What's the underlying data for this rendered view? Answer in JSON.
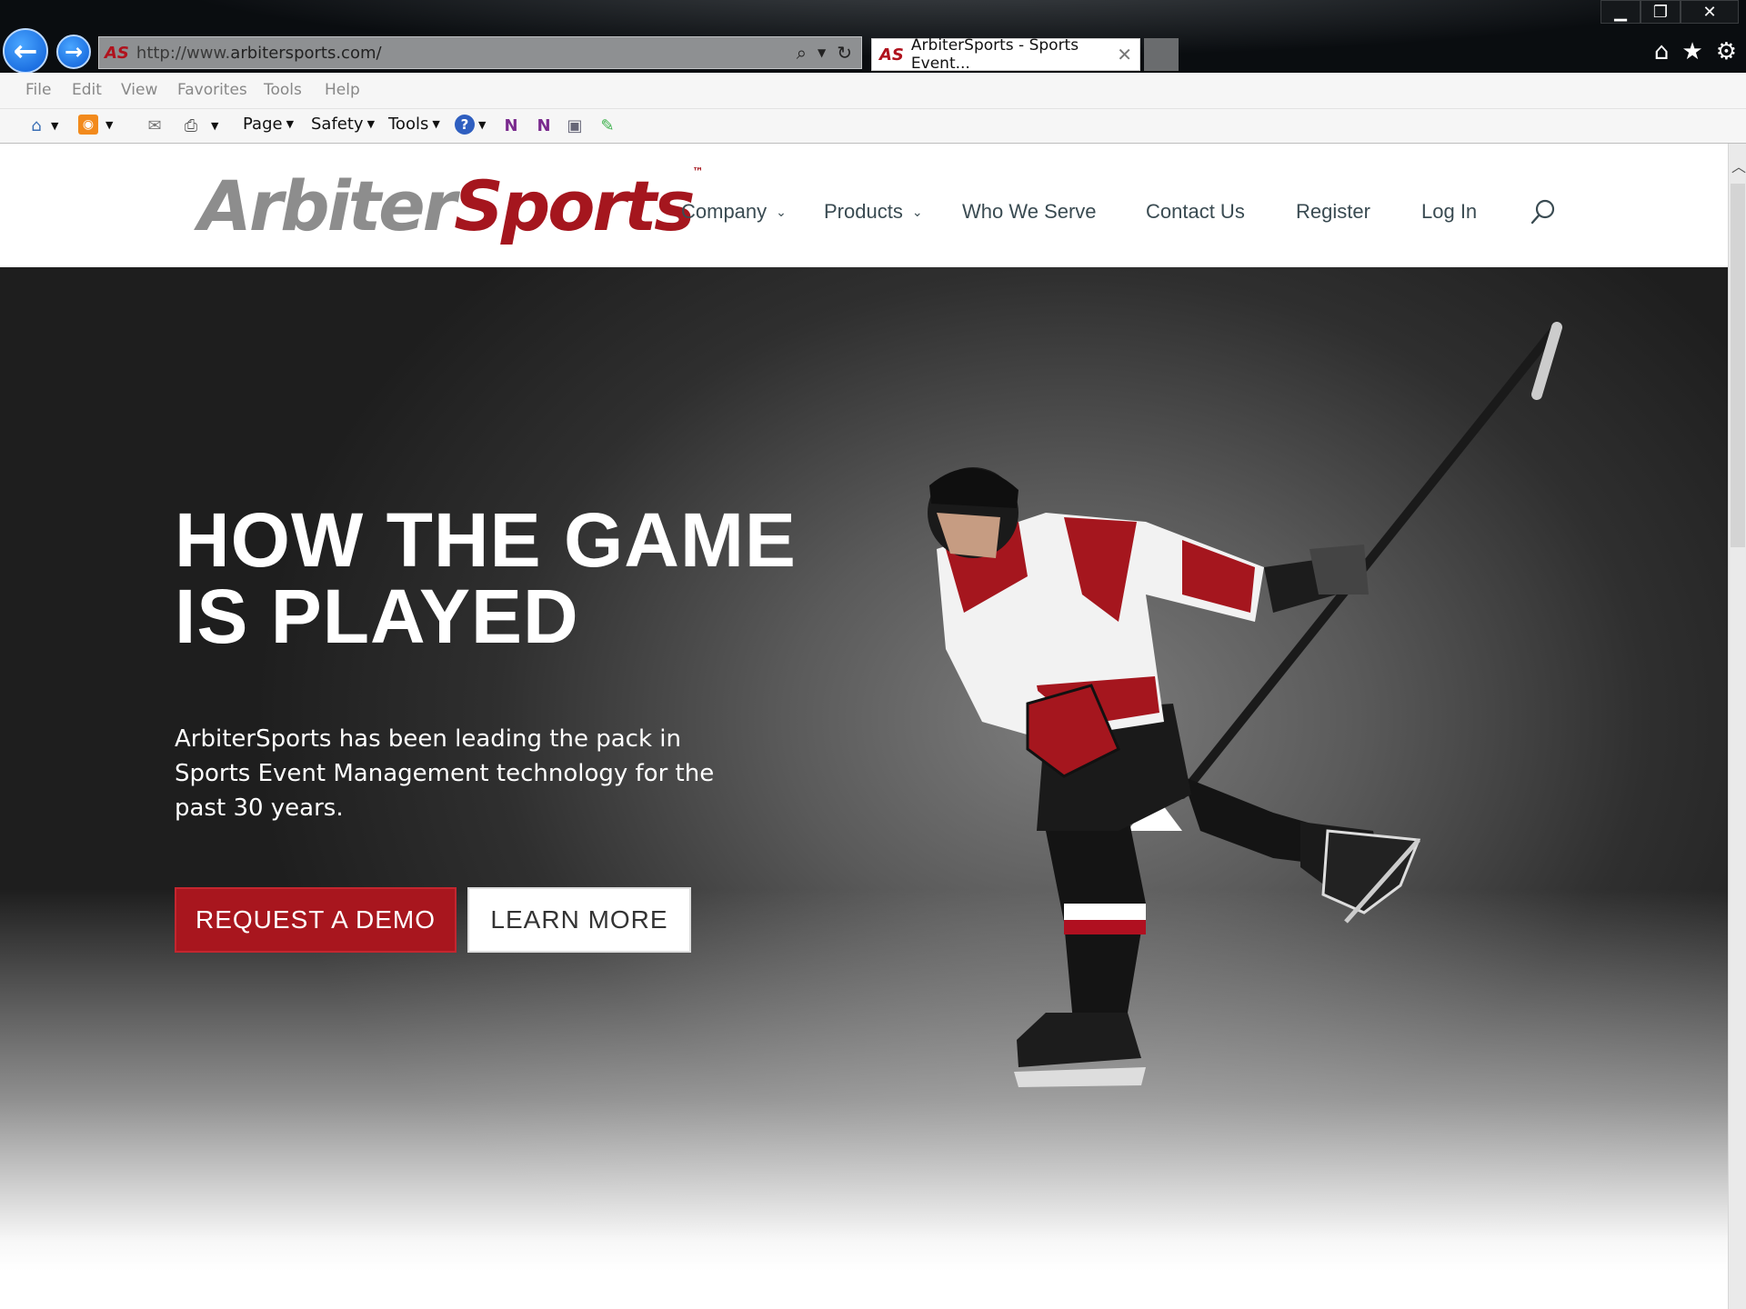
{
  "browser": {
    "url_prefix": "http://www.",
    "url_domain": "arbitersports.com/",
    "tab_title": "ArbiterSports - Sports Event...",
    "favicon_text": "AS",
    "menu": [
      "File",
      "Edit",
      "View",
      "Favorites",
      "Tools",
      "Help"
    ],
    "commands": {
      "page": "Page",
      "safety": "Safety",
      "tools": "Tools"
    },
    "window_controls": {
      "minimize": "▁",
      "restore": "❐",
      "close": "✕"
    },
    "icons": [
      "back-arrow-icon",
      "forward-arrow-icon",
      "search-icon",
      "refresh-icon",
      "home-icon",
      "favorites-star-icon",
      "settings-gear-icon",
      "rss-feed-icon",
      "print-icon",
      "help-icon",
      "onenote-icon"
    ]
  },
  "site": {
    "logo": {
      "part1": "Arbiter",
      "part2": "Sports",
      "tm": "™"
    },
    "nav": {
      "company": "Company",
      "products": "Products",
      "who_we_serve": "Who We Serve",
      "contact": "Contact Us",
      "register": "Register",
      "login": "Log In"
    },
    "hero": {
      "headline_line1": "HOW THE GAME",
      "headline_line2": "IS PLAYED",
      "subtext": "ArbiterSports has been leading the pack in Sports Event Management technology for the past 30 years.",
      "cta_primary": "REQUEST A DEMO",
      "cta_secondary": "LEARN MORE"
    },
    "colors": {
      "brand_red": "#a5161e",
      "logo_gray": "#8d8d8d",
      "nav_text": "#3a4b52"
    }
  }
}
